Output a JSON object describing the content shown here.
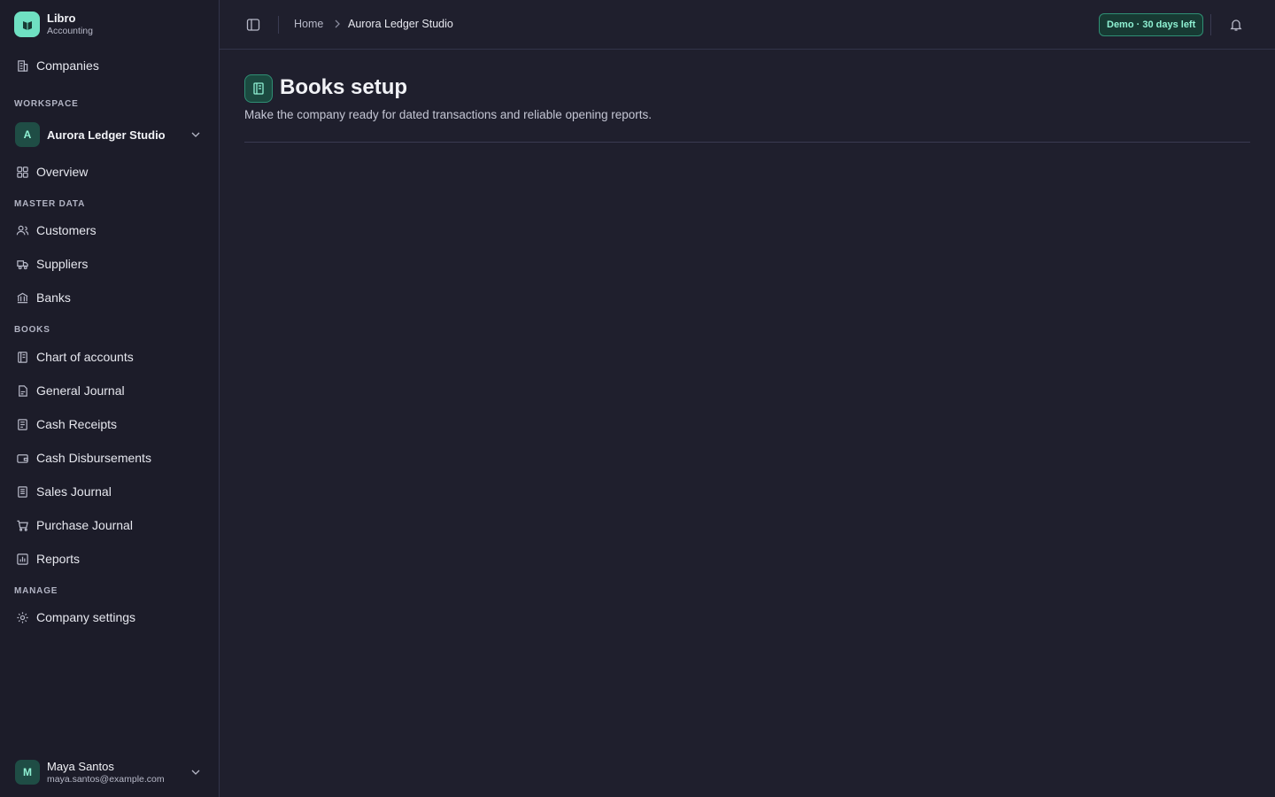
{
  "brand": {
    "name": "Libro",
    "subtitle": "Accounting"
  },
  "sidebar": {
    "companies": "Companies",
    "sections": {
      "workspace": "WORKSPACE",
      "master_data": "MASTER DATA",
      "books": "BOOKS",
      "manage": "MANAGE"
    },
    "workspace": {
      "avatar": "A",
      "name": "Aurora Ledger Studio"
    },
    "overview": "Overview",
    "master_data_items": [
      "Customers",
      "Suppliers",
      "Banks"
    ],
    "books_items": [
      "Chart of accounts",
      "General Journal",
      "Cash Receipts",
      "Cash Disbursements",
      "Sales Journal",
      "Purchase Journal",
      "Reports"
    ],
    "manage_items": [
      "Company settings"
    ]
  },
  "user": {
    "avatar": "M",
    "name": "Maya Santos",
    "email": "maya.santos@example.com"
  },
  "topbar": {
    "breadcrumb_home": "Home",
    "breadcrumb_current": "Aurora Ledger Studio",
    "demo_badge": "Demo · 30 days left"
  },
  "page": {
    "title": "Books setup",
    "subtitle": "Make the company ready for dated transactions and reliable opening reports."
  },
  "colors": {
    "accent": "#6fe0c2",
    "background": "#1f1f2d",
    "sidebar": "#1c1c29"
  }
}
